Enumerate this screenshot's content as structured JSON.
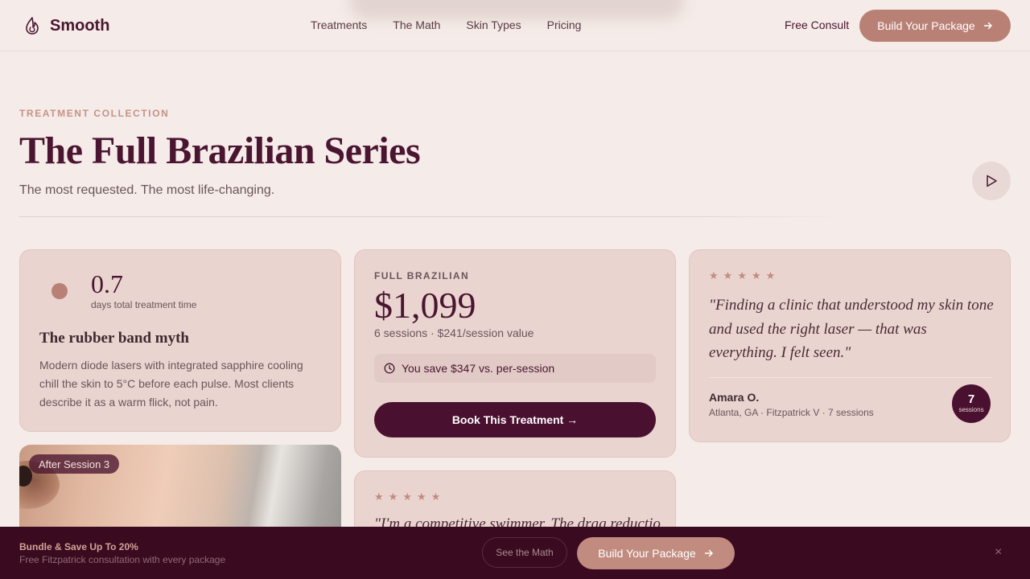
{
  "brand": {
    "name": "Smooth",
    "logo_icon": "flame-icon"
  },
  "nav": {
    "items": [
      "Treatments",
      "The Math",
      "Skin Types",
      "Pricing"
    ]
  },
  "header": {
    "free_consult": "Free Consult",
    "build_package": "Build Your Package"
  },
  "hero": {
    "eyebrow": "TREATMENT COLLECTION",
    "title": "The Full Brazilian Series",
    "subtitle": "The most requested. The most life-changing."
  },
  "myth_card": {
    "stat": "0.7",
    "stat_label": "days total treatment time",
    "title": "The rubber band myth",
    "body": "Modern diode lasers with integrated sapphire cooling chill the skin to 5°C before each pulse. Most clients describe it as a warm flick, not pain."
  },
  "photo_card": {
    "badge": "After Session 3"
  },
  "price_card": {
    "eyebrow": "FULL BRAZILIAN",
    "price": "$1,099",
    "sessions": "6 sessions · $241/session value",
    "savings": "You save $347 vs. per-session",
    "cta": "Book This Treatment →"
  },
  "testimonial": {
    "rating": 5,
    "quote": "\"Finding a clinic that understood my skin tone and used the right laser — that was everything. I felt seen.\"",
    "name": "Amara O.",
    "meta": "Atlanta, GA · Fitzpatrick V · 7 sessions",
    "session_count": "7",
    "session_label": "sessions"
  },
  "testimonial2": {
    "rating": 5,
    "quote": "\"I'm a competitive swimmer. The drag reduction"
  },
  "bottom_bar": {
    "title": "Bundle & Save Up To 20%",
    "subtitle": "Free Fitzpatrick consultation with every package",
    "see_math": "See the Math",
    "build_package": "Build Your Package",
    "close": "×"
  },
  "colors": {
    "background": "#f5ebe8",
    "accent": "#b98176",
    "primary_dark": "#4a1030",
    "card": "#ead4d0",
    "bottom_bar": "#3a0a20"
  }
}
